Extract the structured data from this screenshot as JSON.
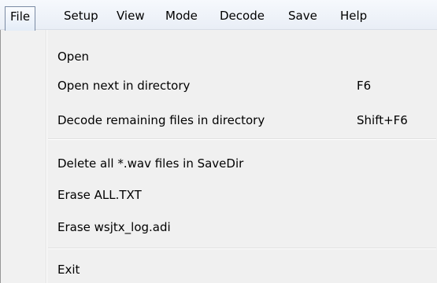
{
  "menubar": {
    "items": [
      {
        "label": "File",
        "active": true
      },
      {
        "label": "Setup"
      },
      {
        "label": "View"
      },
      {
        "label": "Mode"
      },
      {
        "label": "Decode"
      },
      {
        "label": "Save"
      },
      {
        "label": "Help"
      }
    ]
  },
  "file_menu": {
    "items": [
      {
        "label": "Open",
        "shortcut": ""
      },
      {
        "label": "Open next in directory",
        "shortcut": "F6"
      },
      {
        "label": "Decode remaining files in directory",
        "shortcut": "Shift+F6"
      },
      {
        "label": "Delete all *.wav files in SaveDir",
        "shortcut": ""
      },
      {
        "label": "Erase ALL.TXT",
        "shortcut": ""
      },
      {
        "label": "Erase wsjtx_log.adi",
        "shortcut": ""
      },
      {
        "label": "Exit",
        "shortcut": ""
      }
    ]
  },
  "colors": {
    "menubar_bg": "#eef2f8",
    "dropdown_bg": "#f0f0f0",
    "active_border": "#7a8aa3"
  }
}
